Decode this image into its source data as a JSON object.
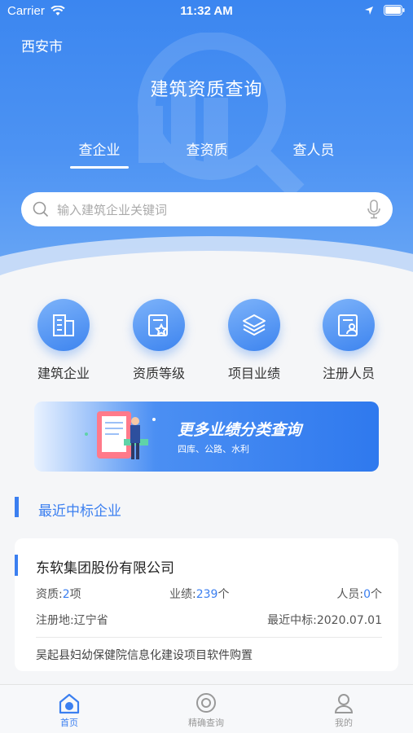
{
  "status_bar": {
    "carrier": "Carrier",
    "time": "11:32 AM"
  },
  "header": {
    "city": "西安市",
    "title": "建筑资质查询"
  },
  "tabs": [
    {
      "label": "查企业",
      "active": true
    },
    {
      "label": "查资质",
      "active": false
    },
    {
      "label": "查人员",
      "active": false
    }
  ],
  "search": {
    "placeholder": "输入建筑企业关键词"
  },
  "categories": [
    {
      "label": "建筑企业",
      "icon": "building-icon"
    },
    {
      "label": "资质等级",
      "icon": "certificate-icon"
    },
    {
      "label": "项目业绩",
      "icon": "layers-icon"
    },
    {
      "label": "注册人员",
      "icon": "person-card-icon"
    }
  ],
  "banner": {
    "title": "更多业绩分类查询",
    "subtitle": "四库、公路、水利"
  },
  "section": {
    "title": "最近中标企业"
  },
  "company_card": {
    "name": "东软集团股份有限公司",
    "qual_label": "资质:",
    "qual_num": "2",
    "qual_unit": "项",
    "perf_label": "业绩:",
    "perf_num": "239",
    "perf_unit": "个",
    "staff_label": "人员:",
    "staff_num": "0",
    "staff_unit": "个",
    "reg_label": "注册地:辽宁省",
    "last_bid": "最近中标:2020.07.01",
    "project": "吴起县妇幼保健院信息化建设项目软件购置"
  },
  "tabbar": [
    {
      "label": "首页",
      "active": true,
      "icon": "home-icon"
    },
    {
      "label": "精确查询",
      "active": false,
      "icon": "target-icon"
    },
    {
      "label": "我的",
      "active": false,
      "icon": "user-icon"
    }
  ],
  "colors": {
    "accent": "#3b7ff0",
    "hero": "#3b86f0"
  }
}
